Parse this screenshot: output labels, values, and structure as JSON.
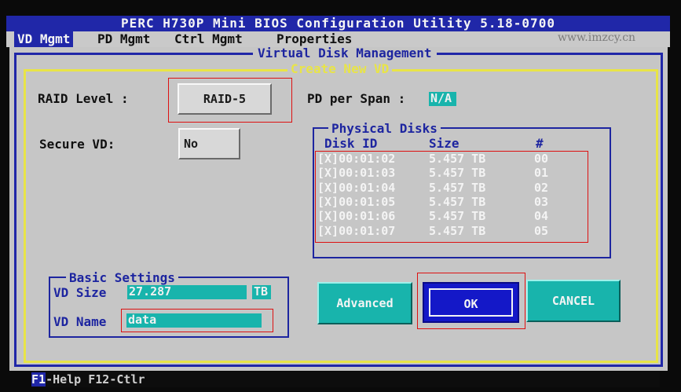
{
  "window": {
    "title": "PERC H730P Mini BIOS Configuration Utility 5.18-0700",
    "watermark": "www.imzcy.cn"
  },
  "tabs": [
    {
      "label": "VD Mgmt",
      "active": true
    },
    {
      "label": "PD Mgmt"
    },
    {
      "label": "Ctrl Mgmt"
    },
    {
      "label": "Properties"
    }
  ],
  "panel": {
    "title": "Virtual Disk Management"
  },
  "dialog": {
    "title": "Create New VD",
    "raid_level": {
      "label": "RAID Level  :",
      "value": "RAID-5"
    },
    "pd_per_span": {
      "label": "PD per Span :",
      "value": "N/A"
    },
    "secure_vd": {
      "label": "Secure VD:",
      "value": "No"
    },
    "physical_disks": {
      "title": "Physical Disks",
      "columns": [
        "Disk ID",
        "Size",
        "#"
      ],
      "rows": [
        {
          "sel": "[X]",
          "id": "00:01:02",
          "size": "5.457 TB",
          "num": "00"
        },
        {
          "sel": "[X]",
          "id": "00:01:03",
          "size": "5.457 TB",
          "num": "01"
        },
        {
          "sel": "[X]",
          "id": "00:01:04",
          "size": "5.457 TB",
          "num": "02"
        },
        {
          "sel": "[X]",
          "id": "00:01:05",
          "size": "5.457 TB",
          "num": "03"
        },
        {
          "sel": "[X]",
          "id": "00:01:06",
          "size": "5.457 TB",
          "num": "04"
        },
        {
          "sel": "[X]",
          "id": "00:01:07",
          "size": "5.457 TB",
          "num": "05"
        }
      ]
    },
    "basic_settings": {
      "title": "Basic Settings",
      "vd_size_label": "VD Size",
      "vd_size_value": "27.287",
      "vd_size_unit": "TB",
      "vd_name_label": "VD Name",
      "vd_name_value": "data"
    },
    "buttons": {
      "advanced": "Advanced",
      "ok": "OK",
      "cancel": "CANCEL"
    }
  },
  "footer": {
    "key": "F1",
    "text": "-Help F12-Ctlr"
  },
  "colors": {
    "title_bar": "#2027a8",
    "panel": "#c6c6c6",
    "accent_cyan": "#18b4ac",
    "dialog_border": "#e8e447",
    "highlight_box": "#dd1111"
  }
}
